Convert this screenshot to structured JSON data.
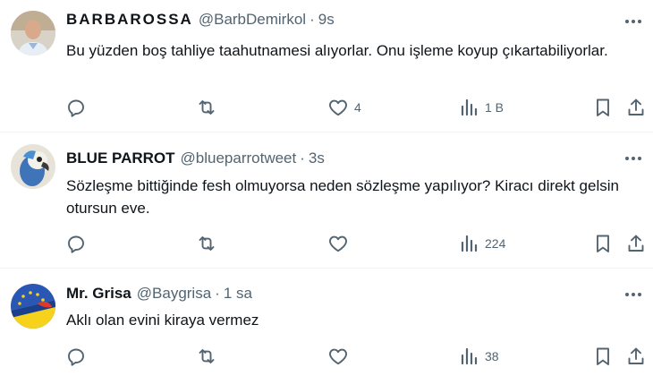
{
  "tweets": [
    {
      "name": "BARBAROSSA",
      "handle": "@BarbDemirkol",
      "dot": "·",
      "time": "9s",
      "text": "Bu yüzden boş tahliye taahutnamesi alıyorlar. Onu işleme koyup çıkartabiliyorlar.",
      "replies": "",
      "retweets": "",
      "likes": "4",
      "views": "1 B"
    },
    {
      "name": "BLUE PARROT",
      "handle": "@blueparrotweet",
      "dot": "·",
      "time": "3s",
      "text": "Sözleşme bittiğinde fesh olmuyorsa neden sözleşme yapılıyor? Kiracı direkt gelsin otursun eve.",
      "replies": "",
      "retweets": "",
      "likes": "",
      "views": "224"
    },
    {
      "name": "Mr. Grisa",
      "handle": "@Baygrisa",
      "dot": "·",
      "time": "1 sa",
      "text": "Aklı olan evini kiraya vermez",
      "replies": "",
      "retweets": "",
      "likes": "",
      "views": "38"
    }
  ],
  "icons": {
    "more": "more-icon",
    "reply": "reply-icon",
    "retweet": "retweet-icon",
    "like": "heart-icon",
    "views": "views-icon",
    "bookmark": "bookmark-icon",
    "share": "share-icon"
  },
  "colors": {
    "text": "#0f1419",
    "secondary": "#536471",
    "divider": "#eff3f4"
  }
}
